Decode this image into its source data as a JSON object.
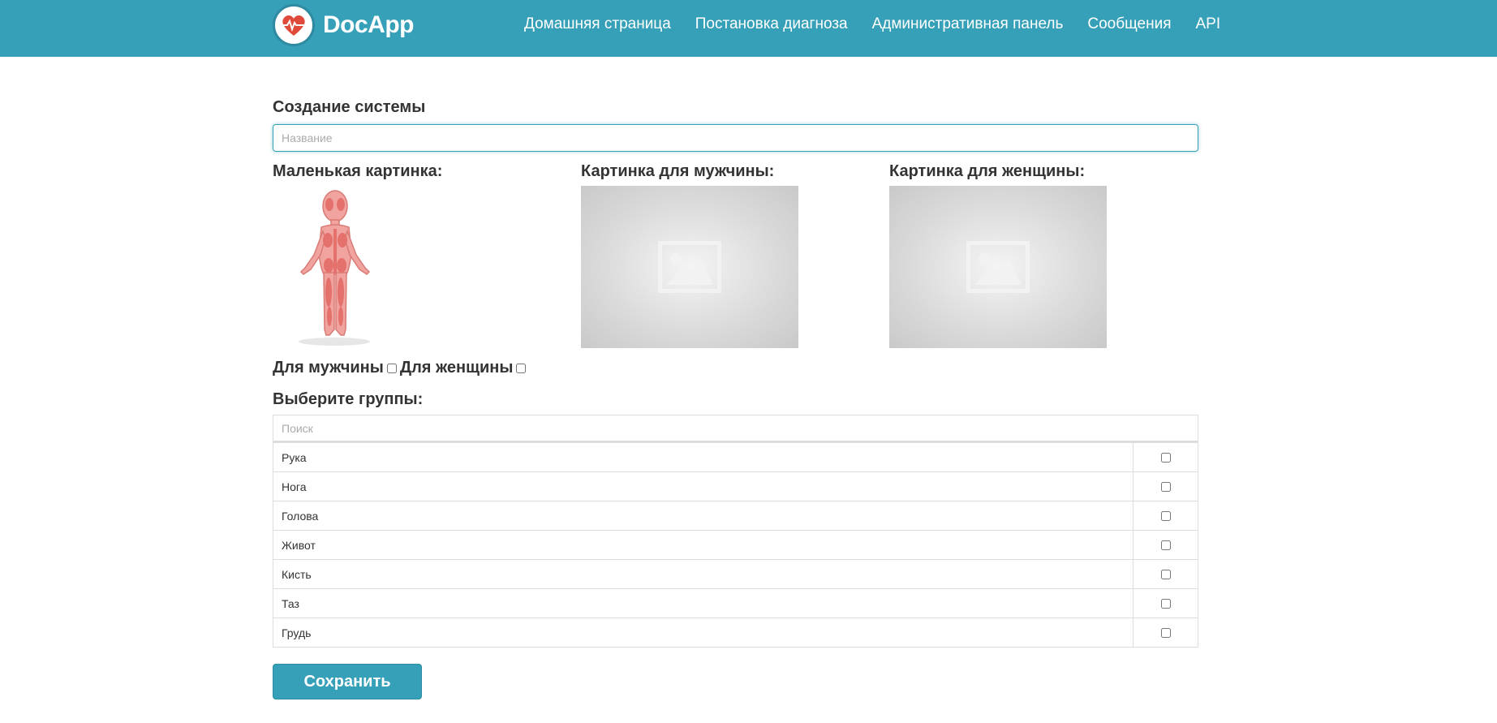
{
  "app": {
    "brand": "DocApp",
    "accent_color": "#37a0b9",
    "logo_icon": "heart-pulse-icon"
  },
  "nav": {
    "items": [
      {
        "label": "Домашняя страница"
      },
      {
        "label": "Постановка диагноза"
      },
      {
        "label": "Административная панель"
      },
      {
        "label": "Сообщения"
      },
      {
        "label": "API"
      }
    ]
  },
  "form": {
    "title": "Создание системы",
    "name_placeholder": "Название",
    "small_image_label": "Маленькая картинка:",
    "male_image_label": "Картинка для мужчины:",
    "female_image_label": "Картинка для женщины:",
    "for_men_label": "Для мужчины",
    "for_women_label": "Для женщины",
    "groups_label": "Выберите группы:",
    "search_placeholder": "Поиск",
    "save_label": "Сохранить"
  },
  "groups": [
    {
      "name": "Рука"
    },
    {
      "name": "Нога"
    },
    {
      "name": "Голова"
    },
    {
      "name": "Живот"
    },
    {
      "name": "Кисть"
    },
    {
      "name": "Таз"
    },
    {
      "name": "Грудь"
    }
  ]
}
